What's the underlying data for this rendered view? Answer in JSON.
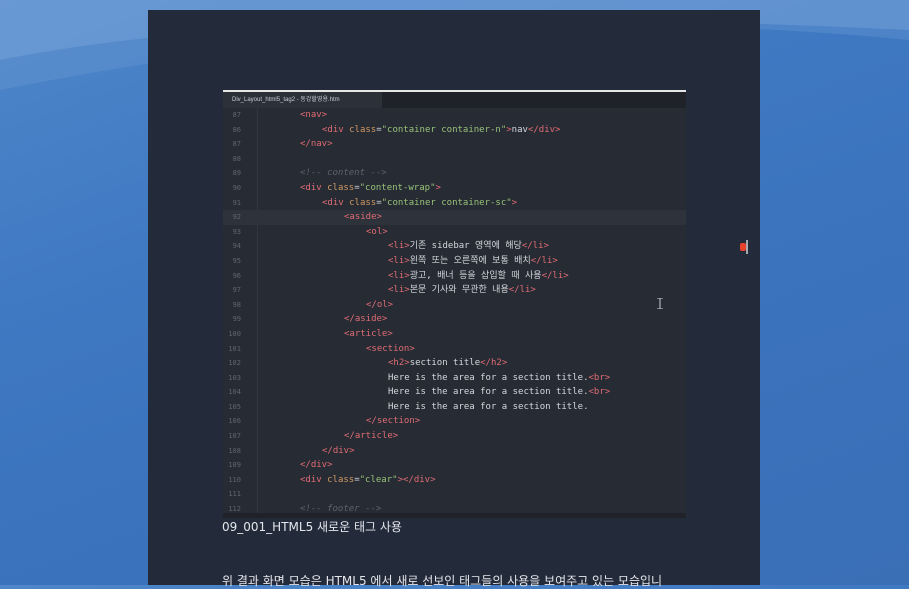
{
  "editor": {
    "tab_title": "Div_Layout_html5_tag2 - 동강할영용.htm",
    "lines": [
      {
        "n": "87",
        "html": "<span class='tag'>&lt;nav&gt;</span>"
      },
      {
        "n": "86",
        "html": "<span class='tag'>&lt;div</span> <span class='attr'>class</span>=<span class='str'>\"container container-n\"</span><span class='tag'>&gt;</span><span class='txt'>nav</span><span class='tag'>&lt;/div&gt;</span>"
      },
      {
        "n": "87",
        "html": "<span class='tag'>&lt;/nav&gt;</span>"
      },
      {
        "n": "88",
        "html": ""
      },
      {
        "n": "89",
        "html": "<span class='com'>&lt;!-- content --&gt;</span>"
      },
      {
        "n": "90",
        "html": "<span class='tag'>&lt;div</span> <span class='attr'>class</span>=<span class='str'>\"content-wrap\"</span><span class='tag'>&gt;</span>"
      },
      {
        "n": "91",
        "html": "<span class='tag'>&lt;div</span> <span class='attr'>class</span>=<span class='str'>\"container container-sc\"</span><span class='tag'>&gt;</span>"
      },
      {
        "n": "92",
        "html": "<span class='tag'>&lt;aside&gt;</span>"
      },
      {
        "n": "93",
        "html": "<span class='tag'>&lt;ol&gt;</span>"
      },
      {
        "n": "94",
        "html": "<span class='tag'>&lt;li&gt;</span><span class='txt'>기존 sidebar 영역에 해당</span><span class='tag'>&lt;/li&gt;</span>"
      },
      {
        "n": "95",
        "html": "<span class='tag'>&lt;li&gt;</span><span class='txt'>왼쪽 또는 오른쪽에 보통 배치</span><span class='tag'>&lt;/li&gt;</span>"
      },
      {
        "n": "96",
        "html": "<span class='tag'>&lt;li&gt;</span><span class='txt'>광고, 배너 등을 삽입할 때 사용</span><span class='tag'>&lt;/li&gt;</span>"
      },
      {
        "n": "97",
        "html": "<span class='tag'>&lt;li&gt;</span><span class='txt'>본문 기사와 무관한 내용</span><span class='tag'>&lt;/li&gt;</span>"
      },
      {
        "n": "98",
        "html": "<span class='tag'>&lt;/ol&gt;</span>"
      },
      {
        "n": "99",
        "html": "<span class='tag'>&lt;/aside&gt;</span>"
      },
      {
        "n": "100",
        "html": "<span class='tag'>&lt;article&gt;</span>"
      },
      {
        "n": "101",
        "html": "<span class='tag'>&lt;section&gt;</span>"
      },
      {
        "n": "102",
        "html": "<span class='tag'>&lt;h2&gt;</span><span class='txt'>section title</span><span class='tag'>&lt;/h2&gt;</span>"
      },
      {
        "n": "103",
        "html": "<span class='txt'>Here is the area for a section title.</span><span class='tag'>&lt;br&gt;</span>"
      },
      {
        "n": "104",
        "html": "<span class='txt'>Here is the area for a section title.</span><span class='tag'>&lt;br&gt;</span>"
      },
      {
        "n": "105",
        "html": "<span class='txt'>Here is the area for a section title.</span>"
      },
      {
        "n": "106",
        "html": "<span class='tag'>&lt;/section&gt;</span>"
      },
      {
        "n": "107",
        "html": "<span class='tag'>&lt;/article&gt;</span>"
      },
      {
        "n": "108",
        "html": "<span class='tag'>&lt;/div&gt;</span>"
      },
      {
        "n": "109",
        "html": "<span class='tag'>&lt;/div&gt;</span>"
      },
      {
        "n": "110",
        "html": "<span class='tag'>&lt;div</span> <span class='attr'>class</span>=<span class='str'>\"clear\"</span><span class='tag'>&gt;&lt;/div&gt;</span>"
      },
      {
        "n": "111",
        "html": ""
      },
      {
        "n": "112",
        "html": "<span class='com'>&lt;!-- footer --&gt;</span>"
      }
    ]
  },
  "caption": "09_001_HTML5 새로운 태그 사용",
  "paragraph": "위 결과 화면 모습은 HTML5 에서 새로 선보인 태그들의 사용을 보여주고 있는 모습입니",
  "colors": {
    "tag": "#e06c75",
    "attr": "#d19a66",
    "string": "#98c379",
    "comment": "#5c6370",
    "editor_bg": "#272b33",
    "page_bg": "#232b3b"
  }
}
